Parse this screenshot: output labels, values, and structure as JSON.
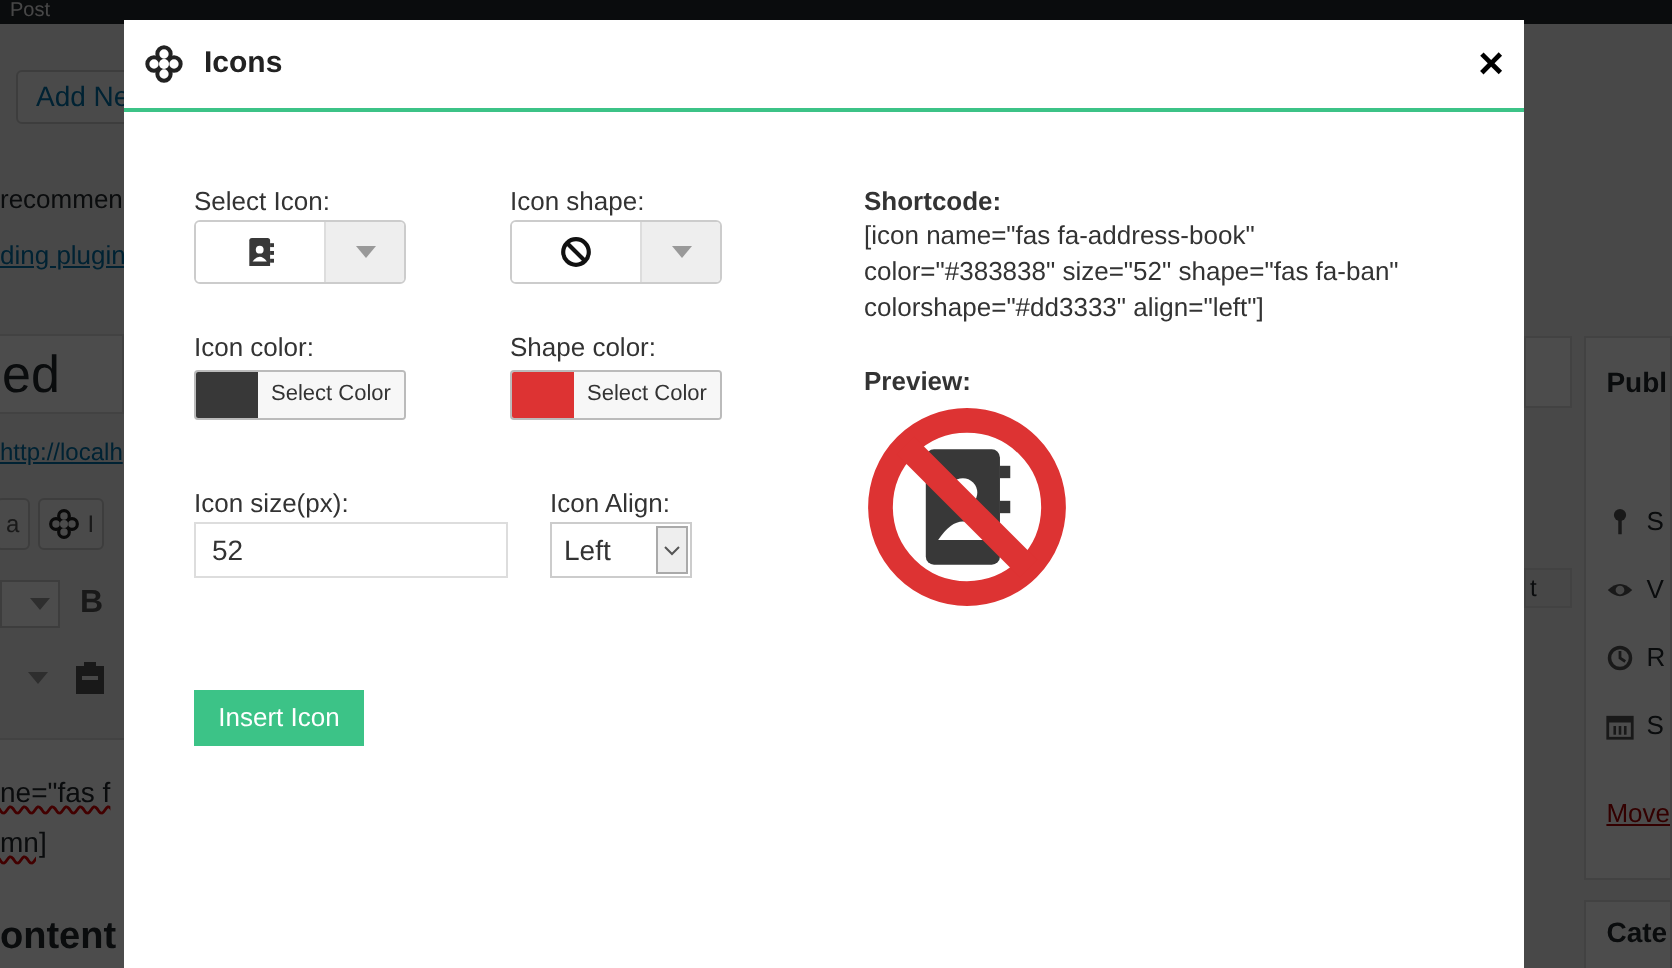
{
  "admin_bar": {
    "label": "Post"
  },
  "editor": {
    "add_new_button": "Add Ne",
    "notice": {
      "text": "recommen",
      "link": "ding plugin"
    },
    "title": "ed",
    "permalink": "http://localh",
    "media_buttons": [
      {
        "kind": "text",
        "label": "a"
      },
      {
        "kind": "icon",
        "label": "I"
      }
    ],
    "bold_button": "B",
    "content_lines": [
      "ne=\"fas f",
      "mn]"
    ],
    "heading": "ontent"
  },
  "sidebar": {
    "tab_label": "t",
    "publish_title": "Publ",
    "items": [
      {
        "kind": "pin",
        "label": "S"
      },
      {
        "kind": "eye",
        "label": "V"
      },
      {
        "kind": "history",
        "label": "R"
      },
      {
        "kind": "calendar",
        "label": "S"
      }
    ],
    "trash_link": "Move",
    "categories_title": "Cate"
  },
  "modal": {
    "title": "Icons",
    "close": "×",
    "select_icon": {
      "label": "Select Icon:"
    },
    "icon_shape": {
      "label": "Icon shape:"
    },
    "icon_color": {
      "label": "Icon color:",
      "color": "#383838",
      "button": "Select Color"
    },
    "shape_color": {
      "label": "Shape color:",
      "color": "#dd3333",
      "button": "Select Color"
    },
    "icon_size": {
      "label": "Icon size(px):",
      "value": "52"
    },
    "icon_align": {
      "label": "Icon Align:",
      "value": "Left"
    },
    "insert_button": "Insert Icon",
    "shortcode": {
      "label": "Shortcode:",
      "lines": [
        "[icon name=\"fas fa-address-book\"",
        "color=\"#383838\" size=\"52\" shape=\"fas fa-ban\"",
        "colorshape=\"#dd3333\" align=\"left\"]"
      ]
    },
    "preview": {
      "label": "Preview:"
    }
  }
}
